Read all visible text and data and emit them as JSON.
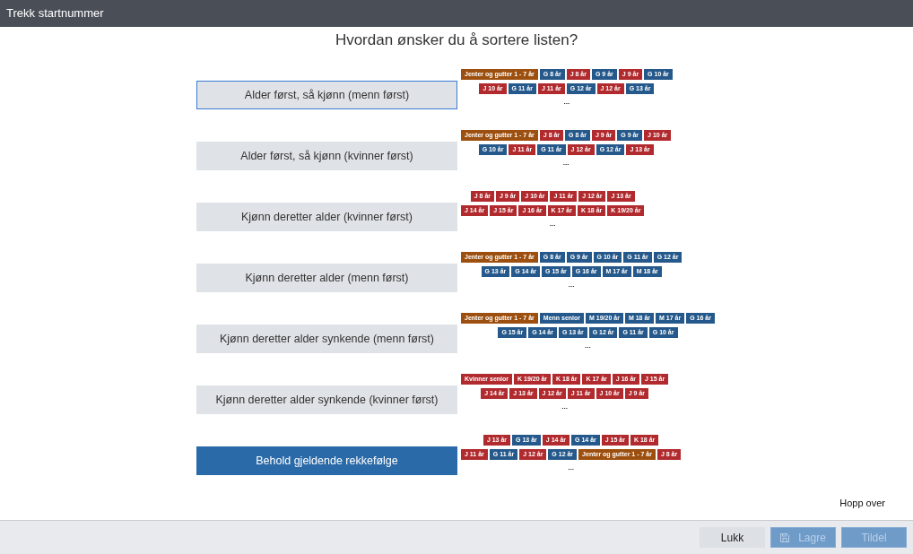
{
  "window": {
    "title": "Trekk startnummer"
  },
  "heading": "Hvordan ønsker du å sortere listen?",
  "options": [
    {
      "label": "Alder først, så kjønn (menn først)",
      "selected": false,
      "focused": true,
      "more": "...",
      "tag_rows": [
        [
          {
            "text": "Jenter og gutter 1 - 7 år",
            "color": "#9c4f0e"
          },
          {
            "text": "G 8 år",
            "color": "#26598b"
          },
          {
            "text": "J 8 år",
            "color": "#b12a2e"
          },
          {
            "text": "G 9 år",
            "color": "#26598b"
          },
          {
            "text": "J 9 år",
            "color": "#b12a2e"
          },
          {
            "text": "G 10 år",
            "color": "#26598b"
          }
        ],
        [
          {
            "text": "J 10 år",
            "color": "#b12a2e"
          },
          {
            "text": "G 11 år",
            "color": "#26598b"
          },
          {
            "text": "J 11 år",
            "color": "#b12a2e"
          },
          {
            "text": "G 12 år",
            "color": "#26598b"
          },
          {
            "text": "J 12 år",
            "color": "#b12a2e"
          },
          {
            "text": "G 13 år",
            "color": "#26598b"
          }
        ]
      ]
    },
    {
      "label": "Alder først, så kjønn (kvinner først)",
      "selected": false,
      "focused": false,
      "more": "...",
      "tag_rows": [
        [
          {
            "text": "Jenter og gutter 1 - 7 år",
            "color": "#9c4f0e"
          },
          {
            "text": "J 8 år",
            "color": "#b12a2e"
          },
          {
            "text": "G 8 år",
            "color": "#26598b"
          },
          {
            "text": "J 9 år",
            "color": "#b12a2e"
          },
          {
            "text": "G 9 år",
            "color": "#26598b"
          },
          {
            "text": "J 10 år",
            "color": "#b12a2e"
          }
        ],
        [
          {
            "text": "G 10 år",
            "color": "#26598b"
          },
          {
            "text": "J 11 år",
            "color": "#b12a2e"
          },
          {
            "text": "G 11 år",
            "color": "#26598b"
          },
          {
            "text": "J 12 år",
            "color": "#b12a2e"
          },
          {
            "text": "G 12 år",
            "color": "#26598b"
          },
          {
            "text": "J 13 år",
            "color": "#b12a2e"
          }
        ]
      ]
    },
    {
      "label": "Kjønn deretter alder (kvinner først)",
      "selected": false,
      "focused": false,
      "more": "...",
      "tag_rows": [
        [
          {
            "text": "J 8 år",
            "color": "#b12a2e"
          },
          {
            "text": "J 9 år",
            "color": "#b12a2e"
          },
          {
            "text": "J 10 år",
            "color": "#b12a2e"
          },
          {
            "text": "J 11 år",
            "color": "#b12a2e"
          },
          {
            "text": "J 12 år",
            "color": "#b12a2e"
          },
          {
            "text": "J 13 år",
            "color": "#b12a2e"
          }
        ],
        [
          {
            "text": "J 14 år",
            "color": "#b12a2e"
          },
          {
            "text": "J 15 år",
            "color": "#b12a2e"
          },
          {
            "text": "J 16 år",
            "color": "#b12a2e"
          },
          {
            "text": "K 17 år",
            "color": "#b12a2e"
          },
          {
            "text": "K 18 år",
            "color": "#b12a2e"
          },
          {
            "text": "K 19/20 år",
            "color": "#b12a2e"
          }
        ]
      ]
    },
    {
      "label": "Kjønn deretter alder (menn først)",
      "selected": false,
      "focused": false,
      "more": "...",
      "tag_rows": [
        [
          {
            "text": "Jenter og gutter 1 - 7 år",
            "color": "#9c4f0e"
          },
          {
            "text": "G 8 år",
            "color": "#26598b"
          },
          {
            "text": "G 9 år",
            "color": "#26598b"
          },
          {
            "text": "G 10 år",
            "color": "#26598b"
          },
          {
            "text": "G 11 år",
            "color": "#26598b"
          },
          {
            "text": "G 12 år",
            "color": "#26598b"
          }
        ],
        [
          {
            "text": "G 13 år",
            "color": "#26598b"
          },
          {
            "text": "G 14 år",
            "color": "#26598b"
          },
          {
            "text": "G 15 år",
            "color": "#26598b"
          },
          {
            "text": "G 16 år",
            "color": "#26598b"
          },
          {
            "text": "M 17 år",
            "color": "#26598b"
          },
          {
            "text": "M 18 år",
            "color": "#26598b"
          }
        ]
      ]
    },
    {
      "label": "Kjønn deretter alder synkende (menn først)",
      "selected": false,
      "focused": false,
      "more": "...",
      "tag_rows": [
        [
          {
            "text": "Jenter og gutter 1 - 7 år",
            "color": "#9c4f0e"
          },
          {
            "text": "Menn senior",
            "color": "#26598b"
          },
          {
            "text": "M 19/20 år",
            "color": "#26598b"
          },
          {
            "text": "M 18 år",
            "color": "#26598b"
          },
          {
            "text": "M 17 år",
            "color": "#26598b"
          },
          {
            "text": "G 16 år",
            "color": "#26598b"
          }
        ],
        [
          {
            "text": "G 15 år",
            "color": "#26598b"
          },
          {
            "text": "G 14 år",
            "color": "#26598b"
          },
          {
            "text": "G 13 år",
            "color": "#26598b"
          },
          {
            "text": "G 12 år",
            "color": "#26598b"
          },
          {
            "text": "G 11 år",
            "color": "#26598b"
          },
          {
            "text": "G 10 år",
            "color": "#26598b"
          }
        ]
      ]
    },
    {
      "label": "Kjønn deretter alder synkende (kvinner først)",
      "selected": false,
      "focused": false,
      "more": "...",
      "tag_rows": [
        [
          {
            "text": "Kvinner senior",
            "color": "#b12a2e"
          },
          {
            "text": "K 19/20 år",
            "color": "#b12a2e"
          },
          {
            "text": "K 18 år",
            "color": "#b12a2e"
          },
          {
            "text": "K 17 år",
            "color": "#b12a2e"
          },
          {
            "text": "J 16 år",
            "color": "#b12a2e"
          },
          {
            "text": "J 15 år",
            "color": "#b12a2e"
          }
        ],
        [
          {
            "text": "J 14 år",
            "color": "#b12a2e"
          },
          {
            "text": "J 13 år",
            "color": "#b12a2e"
          },
          {
            "text": "J 12 år",
            "color": "#b12a2e"
          },
          {
            "text": "J 11 år",
            "color": "#b12a2e"
          },
          {
            "text": "J 10 år",
            "color": "#b12a2e"
          },
          {
            "text": "J 9 år",
            "color": "#b12a2e"
          }
        ]
      ]
    },
    {
      "label": "Behold gjeldende rekkefølge",
      "selected": true,
      "focused": false,
      "more": "...",
      "tag_rows": [
        [
          {
            "text": "J 13 år",
            "color": "#b12a2e"
          },
          {
            "text": "G 13 år",
            "color": "#26598b"
          },
          {
            "text": "J 14 år",
            "color": "#b12a2e"
          },
          {
            "text": "G 14 år",
            "color": "#26598b"
          },
          {
            "text": "J 15 år",
            "color": "#b12a2e"
          },
          {
            "text": "K 18 år",
            "color": "#b12a2e"
          }
        ],
        [
          {
            "text": "J 11 år",
            "color": "#b12a2e"
          },
          {
            "text": "G 11 år",
            "color": "#26598b"
          },
          {
            "text": "J 12 år",
            "color": "#b12a2e"
          },
          {
            "text": "G 12 år",
            "color": "#26598b"
          },
          {
            "text": "Jenter og gutter 1 - 7 år",
            "color": "#9c4f0e"
          },
          {
            "text": "J 8 år",
            "color": "#b12a2e"
          }
        ]
      ]
    }
  ],
  "skip_link": "Hopp over",
  "footer_buttons": [
    {
      "label": "Lukk",
      "kind": "secondary",
      "disabled": false,
      "has_icon": false
    },
    {
      "label": "Lagre",
      "kind": "primary",
      "disabled": true,
      "has_icon": true
    },
    {
      "label": "Tildel",
      "kind": "primary",
      "disabled": true,
      "has_icon": false
    }
  ]
}
